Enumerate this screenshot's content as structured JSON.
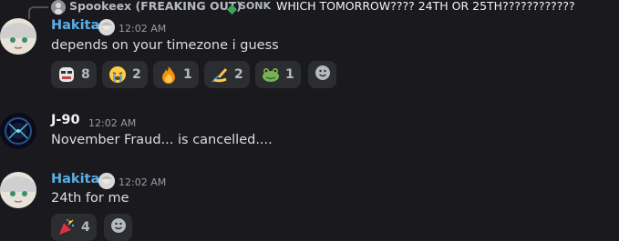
{
  "reply": {
    "author": "Spookeex (FREAKING OUT)",
    "tag": "SONK",
    "text": "WHICH TOMORROW???? 24TH OR 25TH????????????"
  },
  "messages": [
    {
      "author": "Hakita",
      "time": "12:02 AM",
      "text": "depends on your timezone i guess",
      "reactions": [
        {
          "emoji": "mask-face",
          "count": "8"
        },
        {
          "emoji": "crying-face",
          "count": "2"
        },
        {
          "emoji": "fire",
          "count": "1"
        },
        {
          "emoji": "writing-hand",
          "count": "2"
        },
        {
          "emoji": "frog",
          "count": "1"
        }
      ]
    },
    {
      "author": "J-90",
      "time": "12:02 AM",
      "text": "November Fraud... is cancelled....",
      "reactions": []
    },
    {
      "author": "Hakita",
      "time": "12:02 AM",
      "text": "24th for me",
      "reactions": [
        {
          "emoji": "party-popper",
          "count": "4"
        }
      ]
    }
  ],
  "colors": {
    "background": "#1a1a1e",
    "username_blue": "#5aaee6",
    "reaction_bg": "#2b2d31"
  }
}
